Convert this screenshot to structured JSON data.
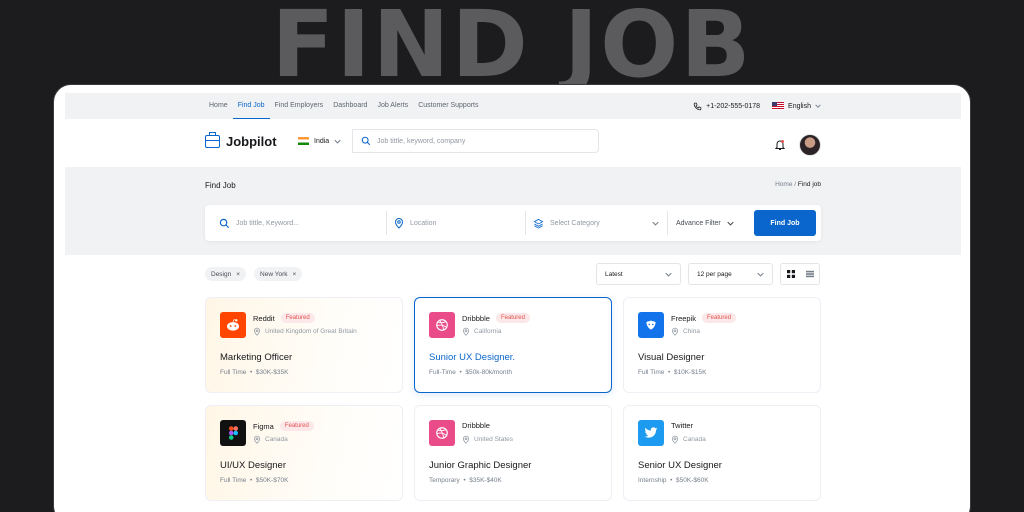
{
  "hero": {
    "title": "FIND JOB"
  },
  "topnav": {
    "links": [
      "Home",
      "Find Job",
      "Find Employers",
      "Dashboard",
      "Job Alerts",
      "Customer Supports"
    ],
    "phone": "+1-202-555-0178",
    "language": "English"
  },
  "header": {
    "brand": "Jobpilot",
    "country": "India",
    "search_placeholder": "Job tittle, keyword, company"
  },
  "band": {
    "title": "Find Job",
    "breadcrumb_home": "Home",
    "breadcrumb_sep": "/",
    "breadcrumb_current": "Find job"
  },
  "filters": {
    "keyword_placeholder": "Job tittle, Keyword...",
    "location_placeholder": "Location",
    "category_placeholder": "Select Category",
    "advance_label": "Advance Filter",
    "find_label": "Find Job"
  },
  "chips": [
    "Design",
    "New York"
  ],
  "sort": {
    "order": "Latest",
    "per_page": "12 per page"
  },
  "jobs": [
    {
      "company": "Reddit",
      "badge": "Featured",
      "location": "United Kingdom of Great Britain",
      "title": "Marketing Officer",
      "type": "Full Time",
      "salary": "$30K-$35K",
      "color": "#ff4500",
      "icon": "reddit-icon"
    },
    {
      "company": "Dribbble",
      "badge": "Featured",
      "location": "California",
      "title": "Sunior UX Designer.",
      "type": "Full-Time",
      "salary": "$50k-80k/month",
      "color": "#ea4c89",
      "icon": "dribbble-icon"
    },
    {
      "company": "Freepik",
      "badge": "Featured",
      "location": "China",
      "title": "Visual Designer",
      "type": "Full Time",
      "salary": "$10K-$15K",
      "color": "#1273eb",
      "icon": "freepik-icon"
    },
    {
      "company": "Figma",
      "badge": "Featured",
      "location": "Canada",
      "title": "UI/UX Designer",
      "type": "Full Time",
      "salary": "$50K-$70K",
      "color": "#111111",
      "icon": "figma-icon"
    },
    {
      "company": "Dribbble",
      "badge": "",
      "location": "United States",
      "title": "Junior Graphic Designer",
      "type": "Temporary",
      "salary": "$35K-$40K",
      "color": "#ea4c89",
      "icon": "dribbble-icon"
    },
    {
      "company": "Twitter",
      "badge": "",
      "location": "Canada",
      "title": "Senior UX Designer",
      "type": "Internship",
      "salary": "$50K-$60K",
      "color": "#1d9bf0",
      "icon": "twitter-icon"
    }
  ],
  "colors": {
    "primary": "#0a65cc",
    "featured_badge_bg": "#fce8e8",
    "featured_badge_text": "#e05151"
  }
}
